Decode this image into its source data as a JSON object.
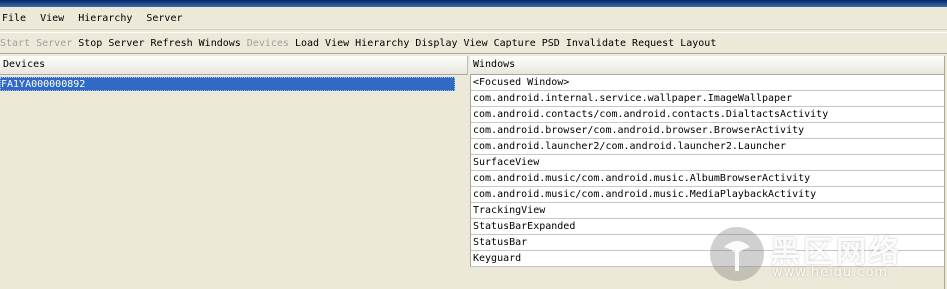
{
  "menubar": {
    "items": [
      "File",
      "View",
      "Hierarchy",
      "Server"
    ]
  },
  "toolbar": {
    "items": [
      {
        "label": "Start Server",
        "enabled": false
      },
      {
        "label": "Stop Server",
        "enabled": true
      },
      {
        "label": "Refresh Windows",
        "enabled": true
      },
      {
        "label": "Devices",
        "enabled": false
      },
      {
        "label": "Load View Hierarchy",
        "enabled": true
      },
      {
        "label": "Display View",
        "enabled": true
      },
      {
        "label": "Capture PSD",
        "enabled": true
      },
      {
        "label": "Invalidate",
        "enabled": true
      },
      {
        "label": "Request Layout",
        "enabled": true
      }
    ]
  },
  "devices": {
    "header": "Devices",
    "rows": [
      "FA1YA000000892"
    ]
  },
  "windows": {
    "header": "Windows",
    "rows": [
      "<Focused Window>",
      "com.android.internal.service.wallpaper.ImageWallpaper",
      "com.android.contacts/com.android.contacts.DialtactsActivity",
      "com.android.browser/com.android.browser.BrowserActivity",
      "com.android.launcher2/com.android.launcher2.Launcher",
      "SurfaceView",
      "com.android.music/com.android.music.AlbumBrowserActivity",
      "com.android.music/com.android.music.MediaPlaybackActivity",
      "TrackingView",
      "StatusBarExpanded",
      "StatusBar",
      "Keyguard"
    ]
  },
  "watermark": {
    "title": "黑区网络",
    "url": "www.heiqu.com"
  },
  "colors": {
    "selection": "#316ac5",
    "background": "#ece9d8"
  }
}
